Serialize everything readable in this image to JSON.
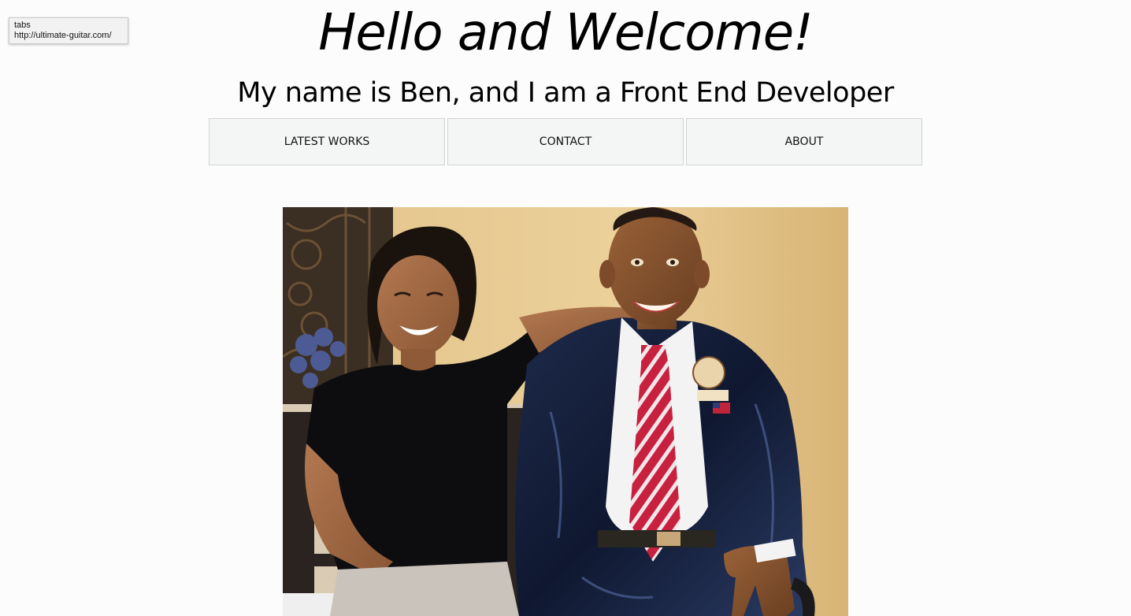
{
  "tooltip": {
    "line1": "tabs",
    "line2": "http://ultimate-guitar.com/"
  },
  "hero": {
    "title": "Hello and Welcome!",
    "subtitle": "My name is Ben, and I am a Front End Developer"
  },
  "nav": {
    "items": [
      {
        "label": "LATEST WORKS"
      },
      {
        "label": "CONTACT"
      },
      {
        "label": "ABOUT"
      }
    ]
  },
  "photo": {
    "tie_colors": [
      "#c8203f",
      "#f1e6e8"
    ],
    "background_color": "#e7c98f"
  }
}
